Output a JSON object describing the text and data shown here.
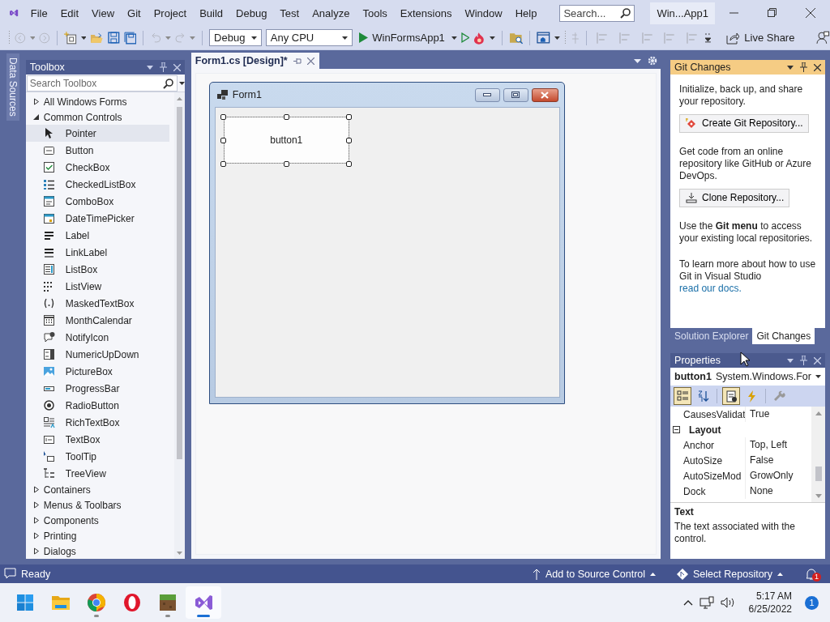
{
  "menu_bar": {
    "items": [
      "File",
      "Edit",
      "View",
      "Git",
      "Project",
      "Build",
      "Debug",
      "Test",
      "Analyze",
      "Tools",
      "Extensions",
      "Window",
      "Help"
    ],
    "search": {
      "placeholder": "Search..."
    },
    "window_title": "Win...App1"
  },
  "toolbar": {
    "configuration": "Debug",
    "platform": "Any CPU",
    "start_target": "WinFormsApp1",
    "live_share": "Live Share"
  },
  "side_tabs": [
    {
      "label": "Data Sources"
    }
  ],
  "toolbox": {
    "title": "Toolbox",
    "search": {
      "placeholder": "Search Toolbox"
    },
    "groups": [
      {
        "label": "All Windows Forms",
        "expanded": false
      },
      {
        "label": "Common Controls",
        "expanded": true,
        "children": [
          {
            "label": "Pointer",
            "selected": true
          },
          {
            "label": "Button",
            "selected": false
          },
          {
            "label": "CheckBox",
            "selected": false
          },
          {
            "label": "CheckedListBox",
            "selected": false
          },
          {
            "label": "ComboBox",
            "selected": false
          },
          {
            "label": "DateTimePicker",
            "selected": false
          },
          {
            "label": "Label",
            "selected": false
          },
          {
            "label": "LinkLabel",
            "selected": false
          },
          {
            "label": "ListBox",
            "selected": false
          },
          {
            "label": "ListView",
            "selected": false
          },
          {
            "label": "MaskedTextBox",
            "selected": false
          },
          {
            "label": "MonthCalendar",
            "selected": false
          },
          {
            "label": "NotifyIcon",
            "selected": false
          },
          {
            "label": "NumericUpDown",
            "selected": false
          },
          {
            "label": "PictureBox",
            "selected": false
          },
          {
            "label": "ProgressBar",
            "selected": false
          },
          {
            "label": "RadioButton",
            "selected": false
          },
          {
            "label": "RichTextBox",
            "selected": false
          },
          {
            "label": "TextBox",
            "selected": false
          },
          {
            "label": "ToolTip",
            "selected": false
          },
          {
            "label": "TreeView",
            "selected": false
          }
        ]
      },
      {
        "label": "Containers",
        "expanded": false
      },
      {
        "label": "Menus & Toolbars",
        "expanded": false
      },
      {
        "label": "Components",
        "expanded": false
      },
      {
        "label": "Printing",
        "expanded": false
      },
      {
        "label": "Dialogs",
        "expanded": false
      }
    ]
  },
  "document_tabs": [
    {
      "label": "Form1.cs [Design]*",
      "selected": true
    }
  ],
  "designer": {
    "form_title": "Form1",
    "button": {
      "text": "button1",
      "selected": true
    }
  },
  "git_changes": {
    "title": "Git Changes",
    "intro": "Initialize, back up, and share your repository.",
    "create_button": "Create Git Repository...",
    "clone_intro": "Get code from an online repository like GitHub or Azure DevOps.",
    "clone_button": "Clone Repository...",
    "menu_hint": "Use the **Git menu** to access your existing local repositories.",
    "learn_more": "To learn more about how to use Git in Visual Studio",
    "docs_link": "read our docs."
  },
  "panel_tabs": [
    {
      "label": "Solution Explorer",
      "selected": false
    },
    {
      "label": "Git Changes",
      "selected": true
    }
  ],
  "properties": {
    "title": "Properties",
    "object_name": "button1",
    "object_type": "System.Windows.For",
    "view_buttons": [
      {
        "kind": "categorized",
        "selected": true
      },
      {
        "kind": "alphabetical",
        "selected": false
      },
      {
        "kind": "properties",
        "selected": true
      },
      {
        "kind": "events",
        "selected": false
      },
      {
        "kind": "pages",
        "selected": false
      }
    ],
    "rows": [
      {
        "kind": "property",
        "name": "CausesValidat",
        "value": "True"
      },
      {
        "kind": "category",
        "name": "Layout",
        "expanded": true
      },
      {
        "kind": "property",
        "name": "Anchor",
        "value": "Top, Left"
      },
      {
        "kind": "property",
        "name": "AutoSize",
        "value": "False"
      },
      {
        "kind": "property",
        "name": "AutoSizeMod",
        "value": "GrowOnly"
      },
      {
        "kind": "property",
        "name": "Dock",
        "value": "None"
      }
    ],
    "description": {
      "title": "Text",
      "text": "The text associated with the control."
    }
  },
  "status_bar": {
    "status": "Ready",
    "source_control": "Add to Source Control",
    "repository": "Select Repository",
    "notification_count": "1"
  },
  "taskbar": {
    "apps": [
      {
        "kind": "start",
        "running": false,
        "selected": false
      },
      {
        "kind": "folder",
        "running": false,
        "selected": false
      },
      {
        "kind": "browser",
        "running": true,
        "selected": false
      },
      {
        "kind": "ring",
        "running": false,
        "selected": false
      },
      {
        "kind": "block",
        "running": true,
        "selected": false
      },
      {
        "kind": "ide",
        "running": true,
        "selected": true
      }
    ],
    "time": "5:17 AM",
    "date": "6/25/2022",
    "notification_count": "1"
  }
}
